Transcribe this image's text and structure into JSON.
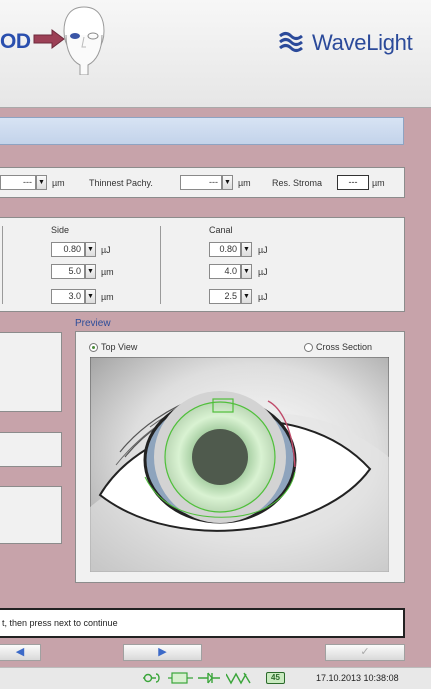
{
  "header": {
    "eye_label": "OD",
    "brand": "WaveLight"
  },
  "treatment_row": {
    "first_value": "---",
    "first_unit": "µm",
    "thinnest_label": "Thinnest Pachy.",
    "thinnest_value": "---",
    "thinnest_unit": "µm",
    "res_stroma_label": "Res. Stroma",
    "res_stroma_value": "---",
    "res_stroma_unit": "µm"
  },
  "energy_panel": {
    "side": {
      "title": "Side",
      "rows": [
        {
          "value": "0.80",
          "unit": "µJ"
        },
        {
          "value": "5.0",
          "unit": "µm"
        },
        {
          "value": "3.0",
          "unit": "µm"
        }
      ]
    },
    "canal": {
      "title": "Canal",
      "rows": [
        {
          "value": "0.80",
          "unit": "µJ"
        },
        {
          "value": "4.0",
          "unit": "µJ"
        },
        {
          "value": "2.5",
          "unit": "µJ"
        }
      ]
    }
  },
  "preview": {
    "title": "Preview",
    "top_view_label": "Top View",
    "cross_section_label": "Cross Section",
    "selected": "top_view"
  },
  "status": {
    "message": "t, then press next to continue"
  },
  "nav": {
    "back_icon": "◀",
    "next_icon": "▶",
    "ok_icon": "✓"
  },
  "taskbar": {
    "badge": "45",
    "datetime": "17.10.2013 10:38:08"
  },
  "colors": {
    "brand": "#2b4a9a",
    "background": "#c7a3aa",
    "accent_green": "#4fbf3a"
  }
}
